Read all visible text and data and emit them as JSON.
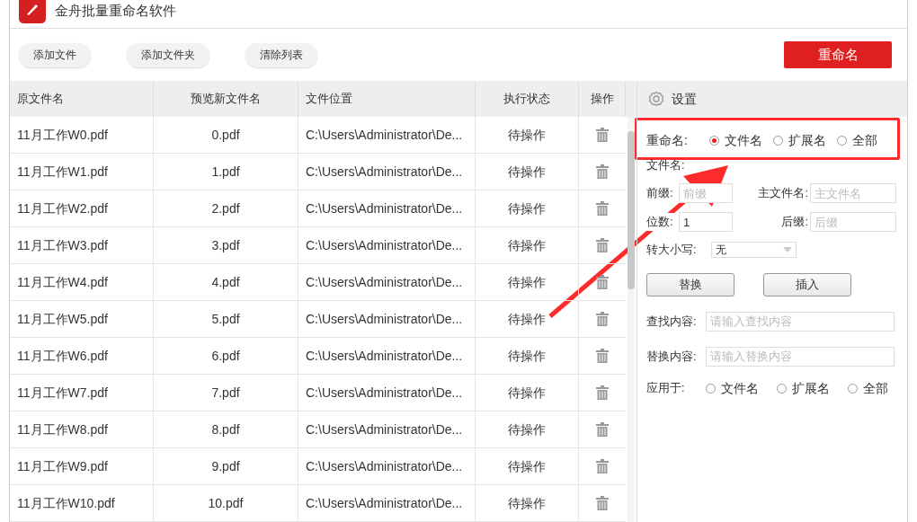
{
  "window": {
    "title": "金舟批量重命名软件"
  },
  "toolbar": {
    "buttons": [
      "添加文件",
      "添加文件夹",
      "清除列表"
    ],
    "primary": "重命名"
  },
  "table": {
    "columns": [
      "原文件名",
      "预览新文件名",
      "文件位置",
      "执行状态",
      "操作"
    ],
    "rows": [
      {
        "name": "11月工作W0.pdf",
        "preview": "0.pdf",
        "location": "C:\\Users\\Administrator\\De...",
        "status": "待操作"
      },
      {
        "name": "11月工作W1.pdf",
        "preview": "1.pdf",
        "location": "C:\\Users\\Administrator\\De...",
        "status": "待操作"
      },
      {
        "name": "11月工作W2.pdf",
        "preview": "2.pdf",
        "location": "C:\\Users\\Administrator\\De...",
        "status": "待操作"
      },
      {
        "name": "11月工作W3.pdf",
        "preview": "3.pdf",
        "location": "C:\\Users\\Administrator\\De...",
        "status": "待操作"
      },
      {
        "name": "11月工作W4.pdf",
        "preview": "4.pdf",
        "location": "C:\\Users\\Administrator\\De...",
        "status": "待操作"
      },
      {
        "name": "11月工作W5.pdf",
        "preview": "5.pdf",
        "location": "C:\\Users\\Administrator\\De...",
        "status": "待操作"
      },
      {
        "name": "11月工作W6.pdf",
        "preview": "6.pdf",
        "location": "C:\\Users\\Administrator\\De...",
        "status": "待操作"
      },
      {
        "name": "11月工作W7.pdf",
        "preview": "7.pdf",
        "location": "C:\\Users\\Administrator\\De...",
        "status": "待操作"
      },
      {
        "name": "11月工作W8.pdf",
        "preview": "8.pdf",
        "location": "C:\\Users\\Administrator\\De...",
        "status": "待操作"
      },
      {
        "name": "11月工作W9.pdf",
        "preview": "9.pdf",
        "location": "C:\\Users\\Administrator\\De...",
        "status": "待操作"
      },
      {
        "name": "11月工作W10.pdf",
        "preview": "10.pdf",
        "location": "C:\\Users\\Administrator\\De...",
        "status": "待操作"
      }
    ]
  },
  "settings": {
    "title": "设置",
    "rename": {
      "label": "重命名:",
      "options": [
        {
          "label": "文件名",
          "selected": true
        },
        {
          "label": "扩展名",
          "selected": false
        },
        {
          "label": "全部",
          "selected": false
        }
      ]
    },
    "filename_label": "文件名:",
    "prefix": {
      "label": "前缀:",
      "placeholder": "前缀"
    },
    "main_name": {
      "label": "主文件名:",
      "placeholder": "主文件名"
    },
    "digits": {
      "label": "位数:",
      "value": "1"
    },
    "suffix": {
      "label": "后缀:",
      "placeholder": "后缀"
    },
    "case": {
      "label": "转大小写:",
      "value": "无"
    },
    "buttons": [
      "替换",
      "插入"
    ],
    "find": {
      "label": "查找内容:",
      "placeholder": "请输入查找内容"
    },
    "replace": {
      "label": "替换内容:",
      "placeholder": "请输入替换内容"
    },
    "apply": {
      "label": "应用于:",
      "options": [
        {
          "label": "文件名",
          "selected": false
        },
        {
          "label": "扩展名",
          "selected": false
        },
        {
          "label": "全部",
          "selected": false
        }
      ]
    }
  }
}
